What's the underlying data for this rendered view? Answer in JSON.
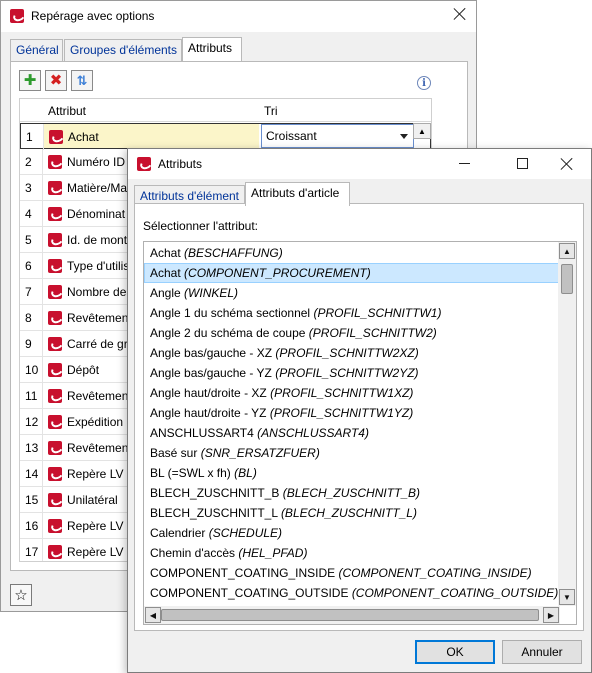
{
  "main_window": {
    "title": "Repérage avec options",
    "tabs": [
      {
        "label": "Général",
        "active": false
      },
      {
        "label": "Groupes d'éléments",
        "active": false
      },
      {
        "label": "Attributs",
        "active": true
      }
    ],
    "toolbar": [
      {
        "icon": "add-icon",
        "color": "#2e9b2e"
      },
      {
        "icon": "delete-icon",
        "color": "#d42020"
      },
      {
        "icon": "sort-icon",
        "color": "#3d7fd6"
      }
    ],
    "grid": {
      "columns": [
        "Attribut",
        "Tri"
      ],
      "rows": [
        {
          "num": "1",
          "attribute": "Achat",
          "sort": "Croissant",
          "selected": true
        },
        {
          "num": "2",
          "attribute": "Numéro ID"
        },
        {
          "num": "3",
          "attribute": "Matière/Ma"
        },
        {
          "num": "4",
          "attribute": "Dénominat"
        },
        {
          "num": "5",
          "attribute": "Id. de mont"
        },
        {
          "num": "6",
          "attribute": "Type d'utilis"
        },
        {
          "num": "7",
          "attribute": "Nombre de"
        },
        {
          "num": "8",
          "attribute": "Revêtemen"
        },
        {
          "num": "9",
          "attribute": "Carré de gr"
        },
        {
          "num": "10",
          "attribute": "Dépôt"
        },
        {
          "num": "11",
          "attribute": "Revêtemen"
        },
        {
          "num": "12",
          "attribute": "Expédition"
        },
        {
          "num": "13",
          "attribute": "Revêtemen"
        },
        {
          "num": "14",
          "attribute": "Repère LV 2"
        },
        {
          "num": "15",
          "attribute": "Unilatéral"
        },
        {
          "num": "16",
          "attribute": "Repère LV 4"
        },
        {
          "num": "17",
          "attribute": "Repère LV 5"
        }
      ]
    }
  },
  "dialog": {
    "title": "Attributs",
    "tabs": [
      {
        "label": "Attributs d'élément",
        "active": false
      },
      {
        "label": "Attributs d'article",
        "active": true
      }
    ],
    "select_label": "Sélectionner l'attribut:",
    "items": [
      {
        "name": "Achat",
        "key": "(BESCHAFFUNG)"
      },
      {
        "name": "Achat",
        "key": "(COMPONENT_PROCUREMENT)",
        "selected": true
      },
      {
        "name": "Angle",
        "key": "(WINKEL)"
      },
      {
        "name": "Angle 1 du schéma sectionnel",
        "key": "(PROFIL_SCHNITTW1)"
      },
      {
        "name": "Angle 2 du schéma de coupe",
        "key": "(PROFIL_SCHNITTW2)"
      },
      {
        "name": "Angle bas/gauche - XZ",
        "key": "(PROFIL_SCHNITTW2XZ)"
      },
      {
        "name": "Angle bas/gauche - YZ",
        "key": "(PROFIL_SCHNITTW2YZ)"
      },
      {
        "name": "Angle haut/droite - XZ",
        "key": "(PROFIL_SCHNITTW1XZ)"
      },
      {
        "name": "Angle haut/droite - YZ",
        "key": "(PROFIL_SCHNITTW1YZ)"
      },
      {
        "name": "ANSCHLUSSART4",
        "key": "(ANSCHLUSSART4)"
      },
      {
        "name": "Basé sur",
        "key": "(SNR_ERSATZFUER)"
      },
      {
        "name": "BL (=SWL x fh)",
        "key": "(BL)"
      },
      {
        "name": "BLECH_ZUSCHNITT_B",
        "key": "(BLECH_ZUSCHNITT_B)"
      },
      {
        "name": "BLECH_ZUSCHNITT_L",
        "key": "(BLECH_ZUSCHNITT_L)"
      },
      {
        "name": "Calendrier",
        "key": "(SCHEDULE)"
      },
      {
        "name": "Chemin d'accès",
        "key": "(HEL_PFAD)"
      },
      {
        "name": "COMPONENT_COATING_INSIDE",
        "key": "(COMPONENT_COATING_INSIDE)"
      },
      {
        "name": "COMPONENT_COATING_OUTSIDE",
        "key": "(COMPONENT_COATING_OUTSIDE)"
      }
    ],
    "ok_label": "OK",
    "cancel_label": "Annuler"
  }
}
